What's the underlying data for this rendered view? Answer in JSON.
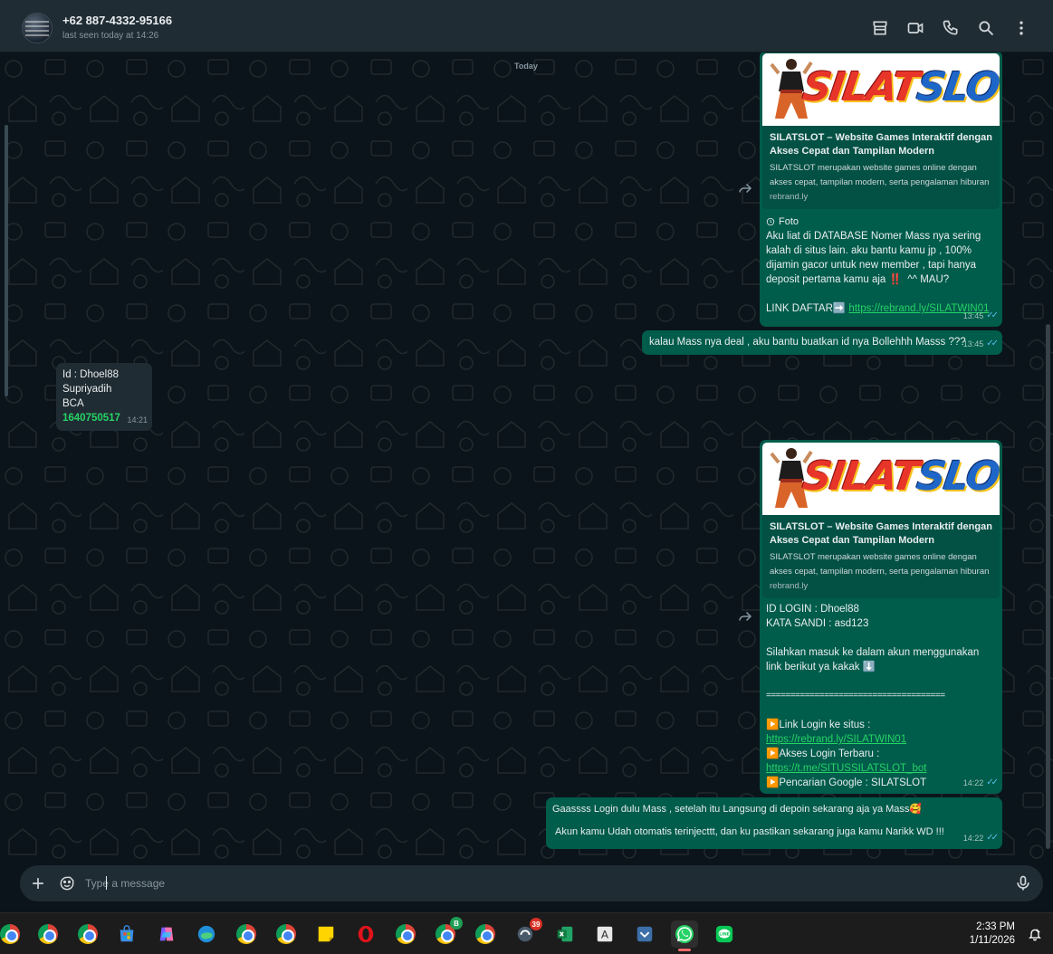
{
  "header": {
    "contact_name": "+62 887-4332-95166",
    "contact_status": "last seen today at 14:26",
    "icons": [
      "shop-icon",
      "video-call-icon",
      "voice-call-icon",
      "search-icon",
      "menu-icon"
    ]
  },
  "chat": {
    "day_label": "Today",
    "messages": {
      "m1": {
        "preview_title": "SILATSLOT – Website Games Interaktif dengan Akses Cepat dan Tampilan Modern",
        "preview_desc": "SILATSLOT merupakan website games online dengan akses cepat, tampilan modern, serta pengalaman hiburan",
        "preview_host": "rebrand.ly",
        "photo_label": "Foto",
        "body": "Aku liat di DATABASE Nomer Mass nya sering kalah di situs lain. aku bantu kamu jp , 100% dijamin gacor untuk new member , tapi hanya deposit pertama kamu aja ‼️  ^^ MAU?",
        "link_prefix": "LINK DAFTAR➡️ ",
        "link": "https://rebrand.ly/SILATWIN01",
        "time": "13:45"
      },
      "m2": {
        "body": "kalau Mass nya deal , aku bantu buatkan id nya Bollehhh Masss ???",
        "time": "13:45"
      },
      "m3": {
        "line1": "Id : Dhoel88",
        "line2": "Supriyadih",
        "line3": "BCA",
        "account": "1640750517",
        "time": "14:21"
      },
      "m4": {
        "preview_title": "SILATSLOT – Website Games Interaktif dengan Akses Cepat dan Tampilan Modern",
        "preview_desc": "SILATSLOT merupakan website games online dengan akses cepat, tampilan modern, serta pengalaman hiburan",
        "preview_host": "rebrand.ly",
        "login": "ID LOGIN : Dhoel88",
        "password": "KATA SANDI : asd123",
        "instruction": "Silahkan masuk ke dalam akun menggunakan link berikut ya kakak ⬇️",
        "divider": "=====================================",
        "login_label": "▶️Link Login ke situs  :",
        "login_link": "https://rebrand.ly/SILATWIN01",
        "alt_label": "▶️Akses Login Terbaru :",
        "alt_link": "https://t.me/SITUSSILATSLOT_bot",
        "google": "▶️Pencarian Google : SILATSLOT",
        "time": "14:22"
      },
      "m5": {
        "line1": "Gaassss Login dulu Mass  , setelah itu Langsung di depoin sekarang aja ya Mass🥰",
        "line2": "Akun kamu Udah otomatis terinjecttt, dan ku pastikan sekarang juga kamu Narikk WD !!!",
        "time": "14:22"
      }
    },
    "logo": {
      "part1": "SILAT",
      "part2": "SLOT"
    }
  },
  "composer": {
    "placeholder": "Type a message"
  },
  "taskbar": {
    "time": "2:33 PM",
    "date": "1/11/2026",
    "badges": {
      "app13": "39",
      "app11": "B"
    }
  },
  "colors": {
    "header_bg": "#202c33",
    "chat_bg": "#0b141a",
    "outgoing": "#005c4b",
    "incoming": "#202c33",
    "accent": "#25d366",
    "ticks": "#53bdeb"
  }
}
